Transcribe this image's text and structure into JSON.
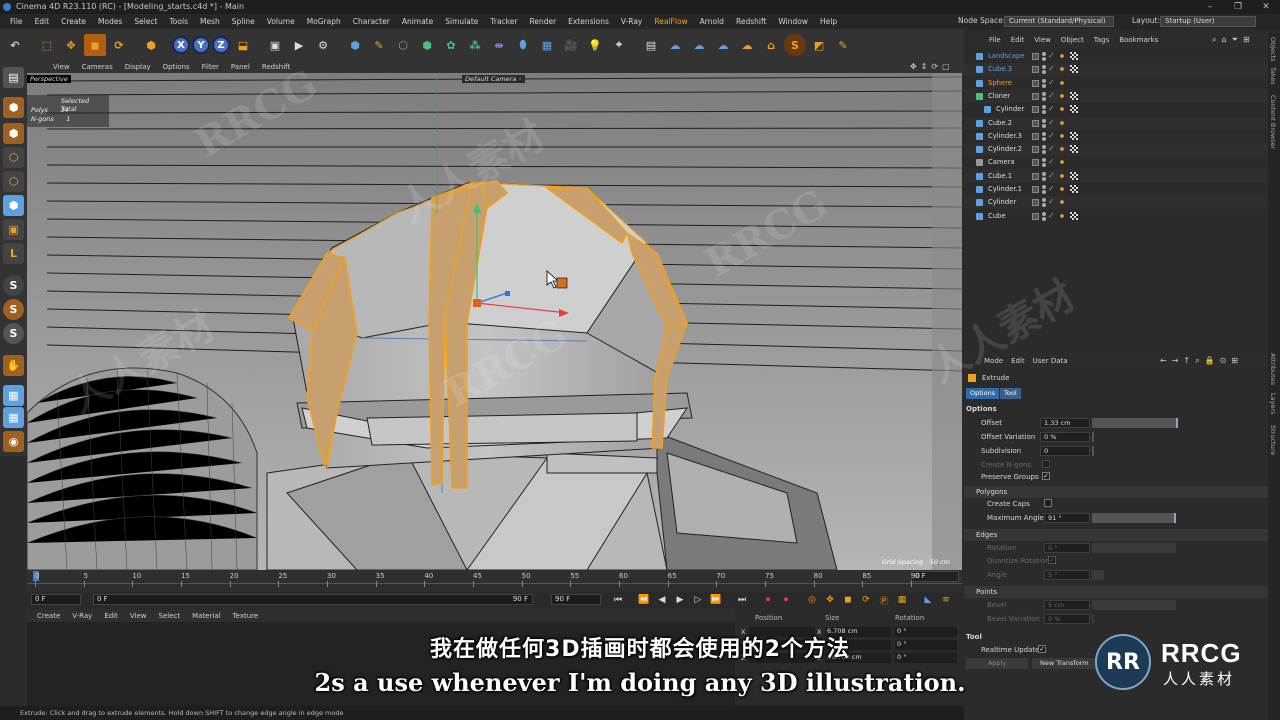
{
  "window": {
    "title": "Cinema 4D R23.110 (RC) - [Modeling_starts.c4d *] - Main"
  },
  "menubar": {
    "items": [
      "File",
      "Edit",
      "Create",
      "Modes",
      "Select",
      "Tools",
      "Mesh",
      "Spline",
      "Volume",
      "MoGraph",
      "Character",
      "Animate",
      "Simulate",
      "Tracker",
      "Render",
      "Extensions",
      "V-Ray",
      "RealFlow",
      "Arnold",
      "Redshift",
      "Window",
      "Help"
    ],
    "node_space_label": "Node Space:",
    "node_space_value": "Current (Standard/Physical)",
    "layout_label": "Layout:",
    "layout_value": "Startup (User)"
  },
  "viewport": {
    "menu": [
      "View",
      "Cameras",
      "Display",
      "Options",
      "Filter",
      "Panel",
      "Redshift"
    ],
    "label": "Perspective",
    "camera": "Default Camera",
    "camera_icon": "camera-dot-icon",
    "hud": {
      "header": "Selected Total",
      "polys_label": "Polys",
      "polys": "34",
      "ngons_label": "N-gons",
      "ngons": "1"
    },
    "grid_spacing": "Grid Spacing : 50 cm"
  },
  "timeline": {
    "ticks": [
      "0",
      "5",
      "10",
      "15",
      "20",
      "25",
      "30",
      "35",
      "40",
      "45",
      "50",
      "55",
      "60",
      "65",
      "70",
      "75",
      "80",
      "85",
      "90"
    ],
    "current_frame": "0 F",
    "start_field": "0 F",
    "start_field2": "0 F",
    "end_field": "90 F",
    "end_field2": "90 F"
  },
  "material": {
    "menu": [
      "Create",
      "V-Ray",
      "Edit",
      "View",
      "Select",
      "Material",
      "Texture"
    ]
  },
  "coordinates": {
    "headers": [
      "Position",
      "Size",
      "Rotation"
    ],
    "rows": [
      {
        "axis": "X",
        "pos": "",
        "size": "6.708 cm",
        "rot": "0 °"
      },
      {
        "axis": "Y",
        "pos": "",
        "size": "",
        "rot": "0 °"
      },
      {
        "axis": "Z",
        "pos": "",
        "size": "56.709 cm",
        "rot": "0 °"
      }
    ]
  },
  "status": "Extrude: Click and drag to extrude elements. Hold down SHIFT to change edge angle in edge mode",
  "object_manager": {
    "menu": [
      "File",
      "Edit",
      "View",
      "Object",
      "Tags",
      "Bookmarks"
    ],
    "objects": [
      {
        "name": "Landscape",
        "indent": 0,
        "color": "#5fa0e0",
        "icon": "landscape-icon"
      },
      {
        "name": "Cube.3",
        "indent": 0,
        "color": "#5fa0e0",
        "icon": "cube-icon"
      },
      {
        "name": "Sphere",
        "indent": 0,
        "color": "#f0a020",
        "icon": "sphere-icon"
      },
      {
        "name": "Cloner",
        "indent": 0,
        "color": "#ddd",
        "icon": "cloner-icon"
      },
      {
        "name": "Cylinder",
        "indent": 1,
        "color": "#ddd",
        "icon": "cylinder-icon"
      },
      {
        "name": "Cube.2",
        "indent": 0,
        "color": "#ddd",
        "icon": "cube-icon"
      },
      {
        "name": "Cylinder.3",
        "indent": 0,
        "color": "#ddd",
        "icon": "cylinder-icon"
      },
      {
        "name": "Cylinder.2",
        "indent": 0,
        "color": "#ddd",
        "icon": "cylinder-icon"
      },
      {
        "name": "Camera",
        "indent": 0,
        "color": "#ddd",
        "icon": "camera-icon"
      },
      {
        "name": "Cube.1",
        "indent": 0,
        "color": "#ddd",
        "icon": "cube-icon"
      },
      {
        "name": "Cylinder.1",
        "indent": 0,
        "color": "#ddd",
        "icon": "cylinder-icon"
      },
      {
        "name": "Cylinder",
        "indent": 0,
        "color": "#ddd",
        "icon": "cylinder-icon"
      },
      {
        "name": "Cube",
        "indent": 0,
        "color": "#ddd",
        "icon": "cube-icon"
      }
    ]
  },
  "side_tabs": [
    "Objects",
    "Takes",
    "Content Browser",
    "Attributes",
    "Layers",
    "Structure"
  ],
  "attributes": {
    "menu": [
      "Mode",
      "Edit",
      "User Data"
    ],
    "tool_name": "Extrude",
    "tabs": [
      "Options",
      "Tool"
    ],
    "options_header": "Options",
    "offset_label": "Offset",
    "offset_value": "1.33 cm",
    "offset_var_label": "Offset Variation",
    "offset_var_value": "0 %",
    "subdivision_label": "Subdivision",
    "subdivision_value": "0",
    "create_ngons_label": "Create N-gons",
    "preserve_groups_label": "Preserve Groups",
    "polygons_header": "Polygons",
    "create_caps_label": "Create Caps",
    "max_angle_label": "Maximum Angle",
    "max_angle_value": "91 °",
    "edges_header": "Edges",
    "rotation_label": "Rotation",
    "rotation_value": "0 °",
    "quantize_label": "Quantize Rotation",
    "angle_label": "Angle",
    "angle_value": "5 °",
    "points_header": "Points",
    "bevel_label": "Bevel",
    "bevel_value": "5 cm",
    "bevel_var_label": "Bevel Variation",
    "bevel_var_value": "0 %",
    "tool_header": "Tool",
    "realtime_label": "Realtime Update",
    "apply_label": "Apply",
    "new_transform_label": "New Transform"
  },
  "subtitles": {
    "cn": "我在做任何3D插画时都会使用的2个方法",
    "en": "2s a use whenever I'm doing any 3D illustration."
  },
  "logo": {
    "brand": "RRCG",
    "sub": "人人素材"
  },
  "watermark": "RRCG",
  "watermark_cn": "人人素材"
}
